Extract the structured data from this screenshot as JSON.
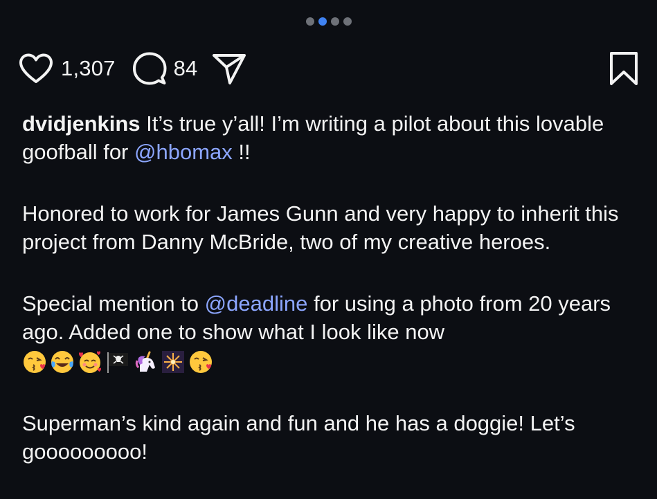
{
  "carousel": {
    "count": 4,
    "active_index": 1
  },
  "actions": {
    "likes": "1,307",
    "comments": "84"
  },
  "icons": {
    "like": "heart-icon",
    "comment": "comment-bubble-icon",
    "share": "send-paper-plane-icon",
    "save": "bookmark-icon"
  },
  "caption": {
    "username": "dvidjenkins",
    "p1_text": " It’s true y’all! I’m writing a pilot about this lovable goofball for ",
    "p1_mention": "@hbomax",
    "p1_tail": " !!",
    "p2_text": "Honored to work for James Gunn and very happy to inherit this project from Danny McBride, two of my creative heroes.",
    "p3_before": "Special mention to ",
    "p3_mention": "@deadline",
    "p3_after": " for using a photo from 20  years ago. Added one to show what I look like now",
    "emojis": [
      "face-blowing-kiss",
      "face-with-tears-of-joy",
      "smiling-face-with-hearts",
      "pirate-flag",
      "unicorn",
      "fireworks",
      "face-blowing-kiss"
    ],
    "p4_text": "Superman’s kind again and fun and he has a doggie! Let’s gooooooooo!"
  },
  "colors": {
    "background": "#0c0e13",
    "text": "#f3f3f3",
    "mention": "#8ca6ff",
    "active_dot": "#3f82f2",
    "inactive_dot": "#6e7178"
  }
}
